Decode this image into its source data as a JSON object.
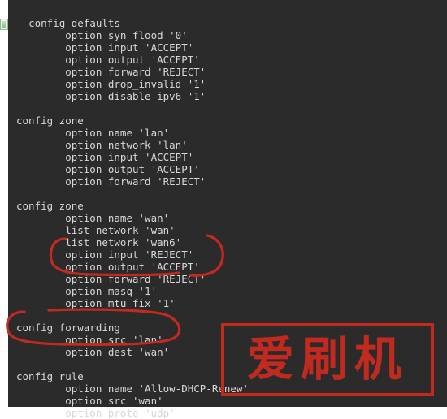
{
  "config_text": "config defaults\n        option syn_flood '0'\n        option input 'ACCEPT'\n        option output 'ACCEPT'\n        option forward 'REJECT'\n        option drop_invalid '1'\n        option disable_ipv6 '1'\n\nconfig zone\n        option name 'lan'\n        option network 'lan'\n        option input 'ACCEPT'\n        option output 'ACCEPT'\n        option forward 'REJECT'\n\nconfig zone\n        option name 'wan'\n        list network 'wan'\n        list network 'wan6'\n        option input 'REJECT'\n        option output 'ACCEPT'\n        option forward 'REJECT'\n        option masq '1'\n        option mtu_fix '1'\n\nconfig forwarding\n        option src 'lan'\n        option dest 'wan'\n\nconfig rule\n        option name 'Allow-DHCP-Renew'\n        option src 'wan'\n        option proto 'udp'",
  "watermark_text": "爱刷机",
  "annotation_color": "#c22a1f"
}
